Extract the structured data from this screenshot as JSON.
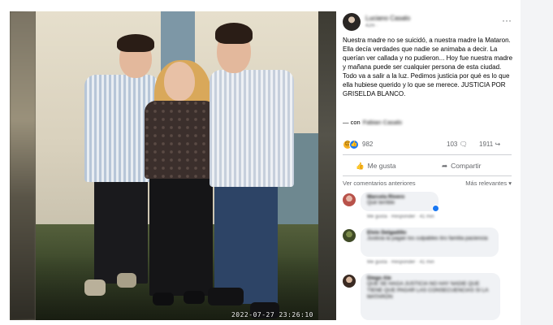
{
  "photo": {
    "timestamp": "2022-07-27 23:26:10"
  },
  "post": {
    "author": "Luciano Casalo",
    "meta": "42m · ",
    "text": "Nuestra madre no se suicidó, a nuestra madre la Mataron. Ella decía verdades que nadie se animaba a decir. La querían ver callada y no pudieron... Hoy fue nuestra madre y mañana puede ser cualquier persona de esta ciudad. Todo va a salir a la luz. Pedimos justicia por qué es lo que ella hubiese querido y lo que se merece. JUSTICIA POR GRISELDA BLANCO.",
    "tagged_prefix": "— con",
    "tagged_name": "Fabian Casalo",
    "reactions_count": "982",
    "comments_count": "103",
    "shares_count": "1911",
    "like_label": "Me gusta",
    "share_label": "Compartir",
    "prev_comments_label": "Ver comentarios anteriores",
    "relevant_label": "Más relevantes"
  },
  "comments": [
    {
      "name": "Marcela Rivero",
      "body": "Qué terrible",
      "meta": "Me gusta · Responder · 41 min"
    },
    {
      "name": "Elvio Delgadillo",
      "body": "Justicia la pagan los culpables tiro familia paciencia",
      "meta": "Me gusta · Responder · 41 min"
    },
    {
      "name": "Diego Ale",
      "body": "QUE SE HAGA JUSTICIA NO HAY NADIE QUE TIENE QUE PAGAR LAS CONSECUENCIAS SI LA MATARON",
      "meta": ""
    }
  ],
  "colors": {
    "like_blue": "#1877f2",
    "text_primary": "#050505",
    "text_secondary": "#65676b",
    "bubble": "#f0f2f5"
  }
}
